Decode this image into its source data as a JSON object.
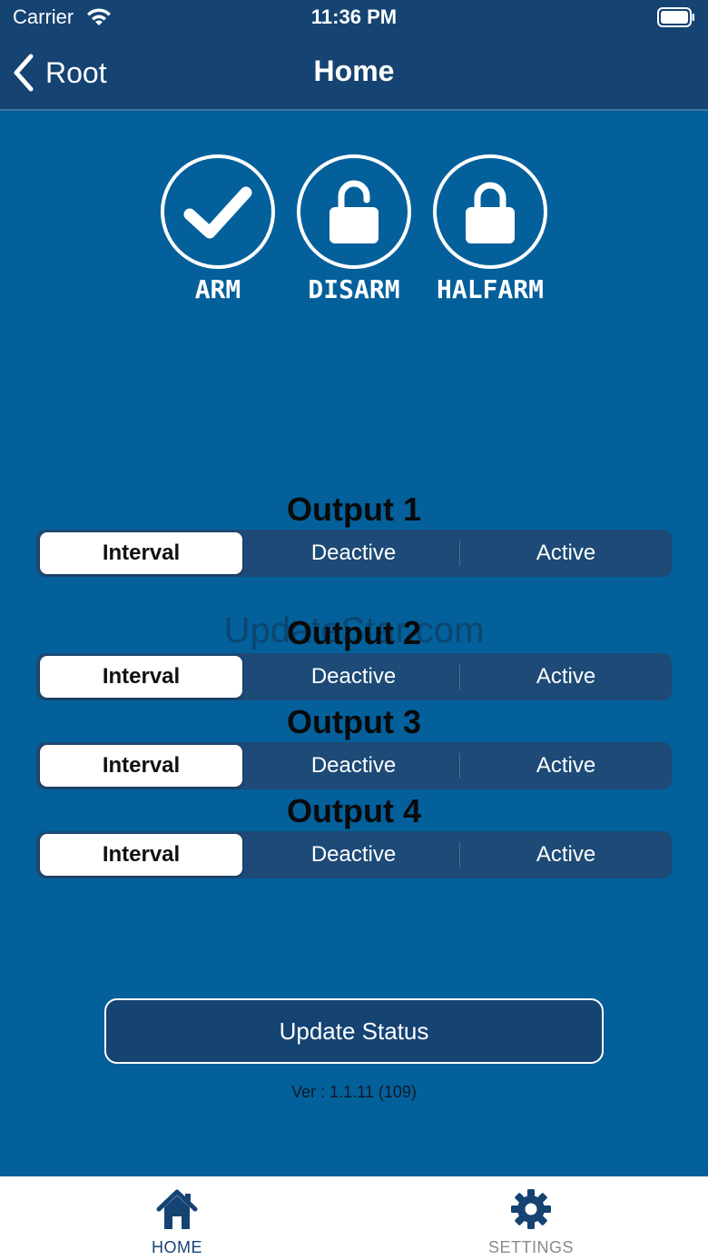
{
  "status_bar": {
    "carrier": "Carrier",
    "time": "11:36 PM"
  },
  "nav": {
    "back_label": "Root",
    "title": "Home"
  },
  "modes": [
    {
      "label": "ARM",
      "icon": "check-icon"
    },
    {
      "label": "DISARM",
      "icon": "unlocked-icon"
    },
    {
      "label": "HALFARM",
      "icon": "locked-icon"
    }
  ],
  "outputs": [
    {
      "title": "Output 1",
      "options": [
        "Interval",
        "Deactive",
        "Active"
      ],
      "selected": "Interval"
    },
    {
      "title": "Output 2",
      "options": [
        "Interval",
        "Deactive",
        "Active"
      ],
      "selected": "Interval"
    },
    {
      "title": "Output 3",
      "options": [
        "Interval",
        "Deactive",
        "Active"
      ],
      "selected": "Interval"
    },
    {
      "title": "Output 4",
      "options": [
        "Interval",
        "Deactive",
        "Active"
      ],
      "selected": "Interval"
    }
  ],
  "watermark": "UpdateStar.com",
  "update_button": "Update Status",
  "version": "Ver : 1.1.11 (109)",
  "tabs": [
    {
      "label": "HOME",
      "icon": "home-icon",
      "active": true
    },
    {
      "label": "SETTINGS",
      "icon": "gear-icon",
      "active": false
    }
  ],
  "colors": {
    "background": "#04609b",
    "navbar": "#154372",
    "segment": "#1d4a76",
    "tab_active": "#154372",
    "tab_inactive": "#8a8a8a"
  }
}
